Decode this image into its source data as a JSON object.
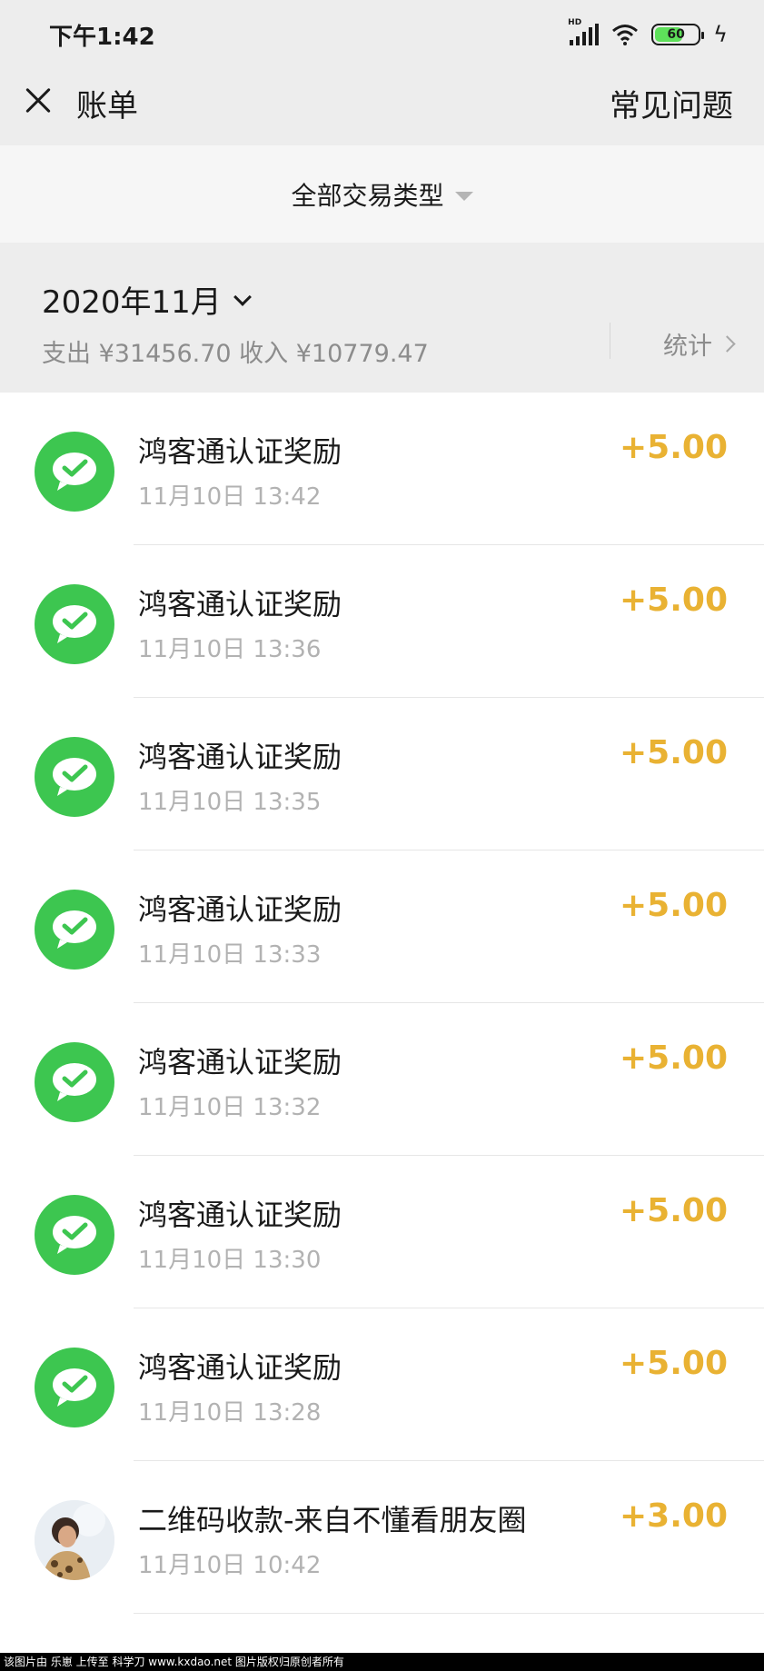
{
  "status_bar": {
    "time": "下午1:42",
    "network": "HD",
    "battery_level": "60",
    "icons": [
      "signal-icon",
      "wifi-icon",
      "battery-icon",
      "charging-bolt-icon"
    ]
  },
  "header": {
    "close_icon": "close-icon",
    "title": "账单",
    "faq_label": "常见问题"
  },
  "filter": {
    "label": "全部交易类型",
    "icon": "caret-down-icon"
  },
  "month": {
    "label": "2020年11月",
    "summary": "支出 ¥31456.70 收入 ¥10779.47",
    "stats_label": "统计"
  },
  "transactions": [
    {
      "icon": "wechat-pay-icon",
      "title": "鸿客通认证奖励",
      "time": "11月10日 13:42",
      "amount": "+5.00"
    },
    {
      "icon": "wechat-pay-icon",
      "title": "鸿客通认证奖励",
      "time": "11月10日 13:36",
      "amount": "+5.00"
    },
    {
      "icon": "wechat-pay-icon",
      "title": "鸿客通认证奖励",
      "time": "11月10日 13:35",
      "amount": "+5.00"
    },
    {
      "icon": "wechat-pay-icon",
      "title": "鸿客通认证奖励",
      "time": "11月10日 13:33",
      "amount": "+5.00"
    },
    {
      "icon": "wechat-pay-icon",
      "title": "鸿客通认证奖励",
      "time": "11月10日 13:32",
      "amount": "+5.00"
    },
    {
      "icon": "wechat-pay-icon",
      "title": "鸿客通认证奖励",
      "time": "11月10日 13:30",
      "amount": "+5.00"
    },
    {
      "icon": "wechat-pay-icon",
      "title": "鸿客通认证奖励",
      "time": "11月10日 13:28",
      "amount": "+5.00"
    },
    {
      "icon": "user-avatar",
      "title": "二维码收款-来自不懂看朋友圈",
      "time": "11月10日 10:42",
      "amount": "+3.00"
    }
  ],
  "footer": {
    "text": "该图片由 乐崽 上传至 科学刀 www.kxdao.net 图片版权归原创者所有"
  },
  "colors": {
    "background_gray": "#ededed",
    "wechat_green": "#3dc650",
    "amount_gold": "#e9b233",
    "secondary_text": "#8c8c8c"
  }
}
